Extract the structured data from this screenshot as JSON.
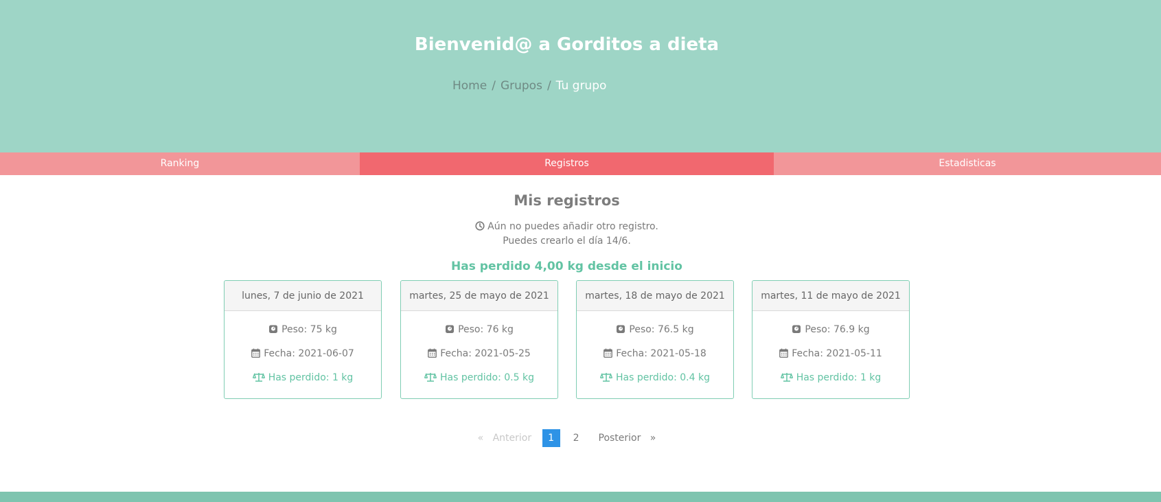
{
  "header": {
    "title": "Bienvenid@ a Gorditos a dieta",
    "breadcrumb": [
      "Home",
      "Grupos",
      "Tu grupo"
    ],
    "separator": "/"
  },
  "tabs": [
    {
      "label": "Ranking",
      "active": false
    },
    {
      "label": "Registros",
      "active": true
    },
    {
      "label": "Estadisticas",
      "active": false
    }
  ],
  "main": {
    "title": "Mis registros",
    "notice_line1": "Aún no puedes añadir otro registro.",
    "notice_line2": "Puedes crearlo el día 14/6.",
    "total_lost": "Has perdido 4,00 kg desde el inicio"
  },
  "records": [
    {
      "date_long": "lunes, 7 de junio de 2021",
      "peso": "Peso: 75 kg",
      "fecha": "Fecha: 2021-06-07",
      "perdido": "Has perdido: 1 kg"
    },
    {
      "date_long": "martes, 25 de mayo de 2021",
      "peso": "Peso: 76 kg",
      "fecha": "Fecha: 2021-05-25",
      "perdido": "Has perdido: 0.5 kg"
    },
    {
      "date_long": "martes, 18 de mayo de 2021",
      "peso": "Peso: 76.5 kg",
      "fecha": "Fecha: 2021-05-18",
      "perdido": "Has perdido: 0.4 kg"
    },
    {
      "date_long": "martes, 11 de mayo de 2021",
      "peso": "Peso: 76.9 kg",
      "fecha": "Fecha: 2021-05-11",
      "perdido": "Has perdido: 1 kg"
    }
  ],
  "pagination": {
    "prev_symbol": "«",
    "prev_label": "Anterior",
    "pages": [
      "1",
      "2"
    ],
    "current": "1",
    "next_label": "Posterior",
    "next_symbol": "»"
  },
  "colors": {
    "hero": "#9ed5c6",
    "tab": "#f29699",
    "tab_active": "#f1686f",
    "accent_green": "#62c3a3",
    "page_active": "#2e93e6",
    "footer": "#7ec4af"
  },
  "icons": {
    "notice": "clock-icon",
    "peso": "weight-icon",
    "fecha": "calendar-icon",
    "perdido": "balance-scale-icon"
  }
}
